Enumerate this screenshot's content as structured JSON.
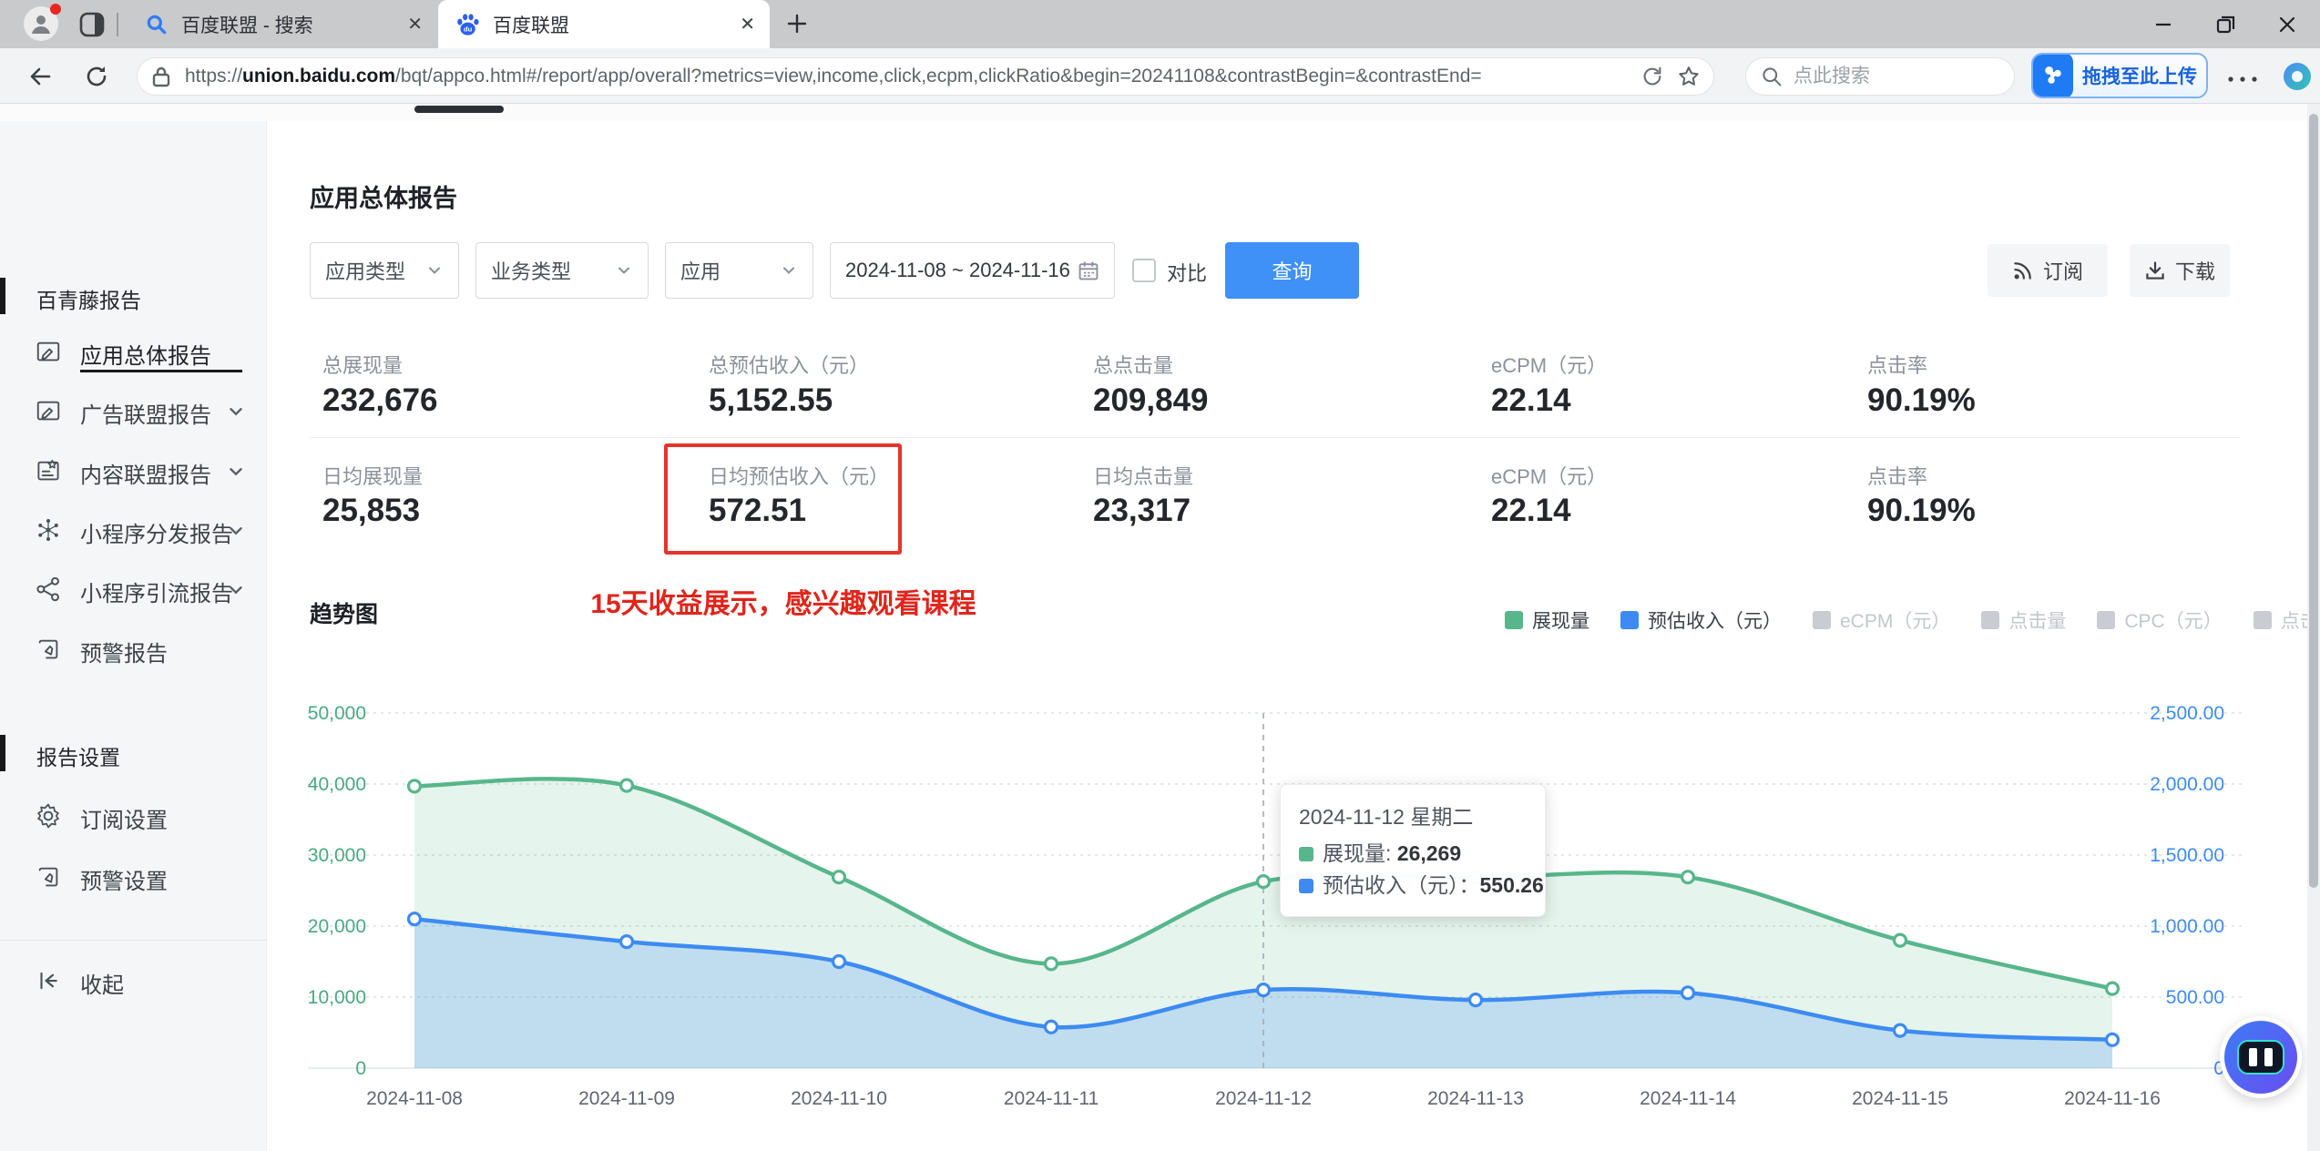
{
  "browser": {
    "tabs": [
      {
        "title": "百度联盟 - 搜索",
        "favicon": "search-favicon",
        "active": false
      },
      {
        "title": "百度联盟",
        "favicon": "baidu-paw-favicon",
        "active": true
      }
    ],
    "url": {
      "scheme": "https://",
      "domain": "union.baidu.com",
      "path": "/bqt/appco.html#/report/app/overall?metrics=view,income,click,ecpm,clickRatio&begin=20241108&contrastBegin=&contrastEnd="
    },
    "search_placeholder": "点此搜索",
    "netdisk_button": "拖拽至此上传"
  },
  "sidebar": {
    "sections": [
      {
        "header": "百青藤报告",
        "items": [
          {
            "label": "应用总体报告",
            "icon": "report-icon",
            "active": true,
            "chevron": false
          },
          {
            "label": "广告联盟报告",
            "icon": "report-icon",
            "active": false,
            "chevron": true
          },
          {
            "label": "内容联盟报告",
            "icon": "content-report-icon",
            "active": false,
            "chevron": true
          },
          {
            "label": "小程序分发报告",
            "icon": "distribution-icon",
            "active": false,
            "chevron": true
          },
          {
            "label": "小程序引流报告",
            "icon": "share-icon",
            "active": false,
            "chevron": true
          },
          {
            "label": "预警报告",
            "icon": "alert-report-icon",
            "active": false,
            "chevron": false
          }
        ]
      },
      {
        "header": "报告设置",
        "items": [
          {
            "label": "订阅设置",
            "icon": "gear-icon",
            "active": false,
            "chevron": false
          },
          {
            "label": "预警设置",
            "icon": "alert-report-icon",
            "active": false,
            "chevron": false
          }
        ]
      }
    ],
    "collapse": {
      "label": "收起",
      "icon": "collapse-icon"
    }
  },
  "report": {
    "page_title": "应用总体报告",
    "filters": {
      "app_type": "应用类型",
      "biz_type": "业务类型",
      "app": "应用",
      "date_range": "2024-11-08 ~ 2024-11-16",
      "compare": "对比",
      "query": "查询",
      "subscribe": "订阅",
      "download": "下载"
    },
    "stats": {
      "rows": [
        [
          {
            "label": "总展现量",
            "value": "232,676"
          },
          {
            "label": "总预估收入（元）",
            "value": "5,152.55"
          },
          {
            "label": "总点击量",
            "value": "209,849"
          },
          {
            "label": "eCPM（元）",
            "value": "22.14"
          },
          {
            "label": "点击率",
            "value": "90.19%"
          }
        ],
        [
          {
            "label": "日均展现量",
            "value": "25,853"
          },
          {
            "label": "日均预估收入（元）",
            "value": "572.51",
            "highlighted": true
          },
          {
            "label": "日均点击量",
            "value": "23,317"
          },
          {
            "label": "eCPM（元）",
            "value": "22.14"
          },
          {
            "label": "点击率",
            "value": "90.19%"
          }
        ]
      ]
    },
    "annotation": {
      "text": "15天收益展示，感兴趣观看课程",
      "color": "#E0251B"
    },
    "trend_title": "趋势图"
  },
  "chart_data": {
    "type": "area",
    "title": "趋势图",
    "categories": [
      "2024-11-08",
      "2024-11-09",
      "2024-11-10",
      "2024-11-11",
      "2024-11-12",
      "2024-11-13",
      "2024-11-14",
      "2024-11-15",
      "2024-11-16"
    ],
    "series": [
      {
        "name": "展现量",
        "axis": "left",
        "color": "#57B68B",
        "fill": "rgba(92,186,142,0.16)",
        "values": [
          39700,
          39800,
          26900,
          14700,
          26269,
          26800,
          26900,
          18000,
          11200
        ]
      },
      {
        "name": "预估收入（元）",
        "axis": "right",
        "color": "#3D8BF2",
        "fill": "rgba(61,139,242,0.22)",
        "values": [
          1050,
          890,
          750,
          290,
          550.26,
          480,
          530,
          265,
          200
        ]
      }
    ],
    "left_axis": {
      "min": 0,
      "max": 50000,
      "ticks": [
        "0",
        "10,000",
        "20,000",
        "30,000",
        "40,000",
        "50,000"
      ],
      "color": "#47A97F"
    },
    "right_axis": {
      "min": 0,
      "max": 2500,
      "ticks": [
        "0",
        "500.00",
        "1,000.00",
        "1,500.00",
        "2,000.00",
        "2,500.00"
      ],
      "color": "#3D8BF2"
    },
    "x_label_color": "#5F6673",
    "grid": "dotted-horizontal",
    "legend_position": "top-right",
    "pointer_index": 4,
    "legend": [
      {
        "label": "展现量",
        "color": "#57B68B",
        "active": true
      },
      {
        "label": "预估收入（元）",
        "color": "#3D8BF2",
        "active": true
      },
      {
        "label": "eCPM（元）",
        "color": "#C9CCD2",
        "active": false
      },
      {
        "label": "点击量",
        "color": "#C9CCD2",
        "active": false
      },
      {
        "label": "CPC（元）",
        "color": "#C9CCD2",
        "active": false
      },
      {
        "label": "点击率",
        "color": "#C9CCD2",
        "active": false
      }
    ],
    "tooltip": {
      "title": "2024-11-12 星期二",
      "rows": [
        {
          "label": "展现量",
          "separator": ": ",
          "value": "26,269",
          "color": "#57B68B"
        },
        {
          "label": "预估收入（元）",
          "separator": "：",
          "value": "550.26",
          "color": "#3D8BF2"
        }
      ]
    }
  }
}
